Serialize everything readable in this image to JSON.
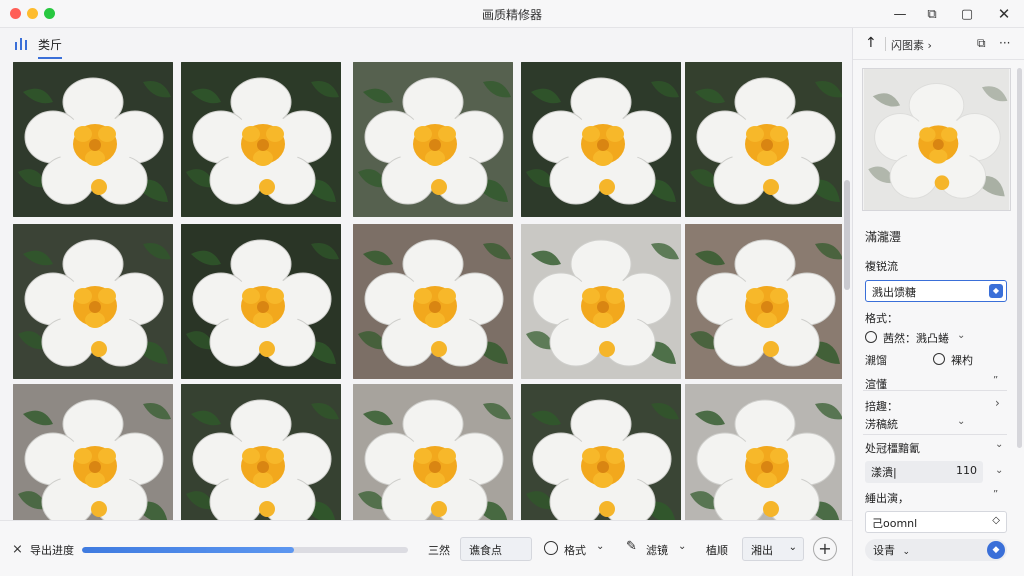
{
  "window": {
    "title": "画质精修器",
    "controls": {
      "minimize": "—",
      "pin": "⧉",
      "maximize": "▢",
      "close": "✕"
    }
  },
  "left_tabs": {
    "active_label": "类斤"
  },
  "grid": {
    "columns": 5,
    "rows": 3,
    "tiles": [
      {
        "bg": "#2f3a2c"
      },
      {
        "bg": "#2c3a28"
      },
      {
        "bg": "#56614f"
      },
      {
        "bg": "#2d3a2a"
      },
      {
        "bg": "#34402e"
      },
      {
        "bg": "#3b4336"
      },
      {
        "bg": "#2a3526"
      },
      {
        "bg": "#7c6f66"
      },
      {
        "bg": "#c9c8c4"
      },
      {
        "bg": "#8a7b70"
      },
      {
        "bg": "#8e8984"
      },
      {
        "bg": "#364131"
      },
      {
        "bg": "#a7a39d"
      },
      {
        "bg": "#3a4535"
      },
      {
        "bg": "#b8b6b2"
      }
    ]
  },
  "bottom_bar": {
    "export_label": "导出进度",
    "progress": 0.65,
    "field1_label": "三然",
    "field1_value": "谯食点",
    "format_label": "格式",
    "filter_label": "滤镜",
    "quality_label": "植顺",
    "quality_value": "湘出",
    "add": "+"
  },
  "right_panel": {
    "up_arrow": "↑",
    "crumb": "闪图素 ›",
    "tool_copy": "⧉",
    "tool_more": "···",
    "section_title": "滿瀧灃",
    "field_label": "複锐流",
    "select_value": "溅出馈糖",
    "format_label": "格式：",
    "radio1_label": "茜然：溅凸蜷",
    "size_label": "瀙馏",
    "radio2_label": "裸杓",
    "speed_label": "渲懂",
    "speed_hint": "”",
    "extra_label": "掊趣：",
    "preset_label": "淓稿統",
    "advanced_label": "处冠橿黯氰",
    "quality_row_label": "漾潰|",
    "quality_row_value": "110",
    "output_label": "綞出演，",
    "output_hint": "”",
    "path_value": "己oomnl",
    "footer_value": "设青"
  }
}
